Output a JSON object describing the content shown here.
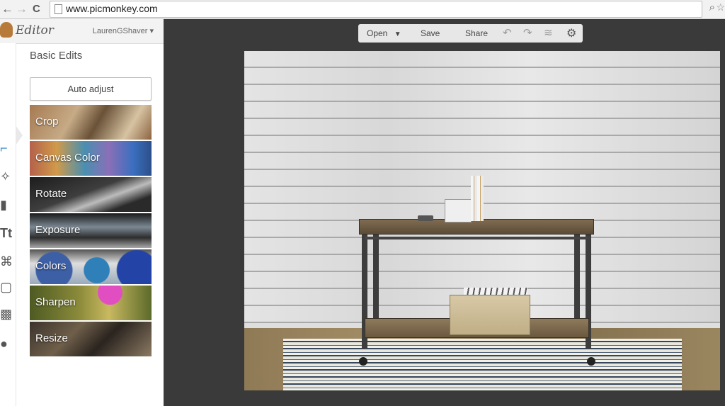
{
  "browser": {
    "url": "www.picmonkey.com",
    "back_glyph": "←",
    "forward_glyph": "→",
    "reload_glyph": "C"
  },
  "sidebar": {
    "app_title": "Editor",
    "username": "LaurenGShaver",
    "panel_title": "Basic Edits",
    "auto_adjust_label": "Auto adjust",
    "tiles": [
      {
        "label": "Crop"
      },
      {
        "label": "Canvas Color"
      },
      {
        "label": "Rotate"
      },
      {
        "label": "Exposure"
      },
      {
        "label": "Colors"
      },
      {
        "label": "Sharpen"
      },
      {
        "label": "Resize"
      }
    ],
    "tools": [
      {
        "name": "crop-tool-icon",
        "glyph": "⌐",
        "active": true
      },
      {
        "name": "magic-wand-icon",
        "glyph": "✧",
        "active": false
      },
      {
        "name": "brush-icon",
        "glyph": "▮",
        "active": false
      },
      {
        "name": "text-icon",
        "glyph": "Tt",
        "active": false
      },
      {
        "name": "butterfly-icon",
        "glyph": "⌘",
        "active": false
      },
      {
        "name": "frame-icon",
        "glyph": "▢",
        "active": false
      },
      {
        "name": "texture-icon",
        "glyph": "▩",
        "active": false
      },
      {
        "name": "apple-icon",
        "glyph": "●",
        "active": false
      }
    ]
  },
  "toolbar": {
    "open_label": "Open",
    "save_label": "Save",
    "share_label": "Share",
    "undo_glyph": "↶",
    "redo_glyph": "↷",
    "layers_glyph": "≋",
    "gear_glyph": "⚙"
  },
  "colors": {
    "accent": "#3a8fc8",
    "workspace": "#3a3a3a"
  }
}
